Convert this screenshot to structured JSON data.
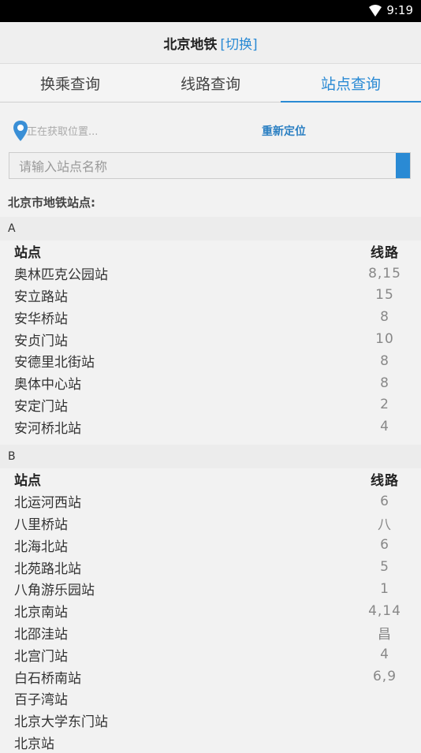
{
  "status": {
    "time": "9:19"
  },
  "header": {
    "title": "北京地铁",
    "switch": "[切换]"
  },
  "tabs": [
    {
      "label": "换乘查询"
    },
    {
      "label": "线路查询"
    },
    {
      "label": "站点查询"
    }
  ],
  "locate": {
    "status": "正在获取位置...",
    "relocate": "重新定位"
  },
  "search": {
    "placeholder": "请输入站点名称"
  },
  "list": {
    "title": "北京市地铁站点:",
    "header": {
      "station": "站点",
      "line": "线路"
    },
    "groups": [
      {
        "letter": "A",
        "rows": [
          {
            "station": "奥林匹克公园站",
            "line": "8,15"
          },
          {
            "station": "安立路站",
            "line": "15"
          },
          {
            "station": "安华桥站",
            "line": "8"
          },
          {
            "station": "安贞门站",
            "line": "10"
          },
          {
            "station": "安德里北街站",
            "line": "8"
          },
          {
            "station": "奥体中心站",
            "line": "8"
          },
          {
            "station": "安定门站",
            "line": "2"
          },
          {
            "station": "安河桥北站",
            "line": "4"
          }
        ]
      },
      {
        "letter": "B",
        "rows": [
          {
            "station": "北运河西站",
            "line": "6"
          },
          {
            "station": "八里桥站",
            "line": "八"
          },
          {
            "station": "北海北站",
            "line": "6"
          },
          {
            "station": "北苑路北站",
            "line": "5"
          },
          {
            "station": "八角游乐园站",
            "line": "1"
          },
          {
            "station": "北京南站",
            "line": "4,14"
          },
          {
            "station": "北邵洼站",
            "line": "昌"
          },
          {
            "station": "北宫门站",
            "line": "4"
          },
          {
            "station": "白石桥南站",
            "line": "6,9"
          },
          {
            "station": "百子湾站",
            "line": ""
          },
          {
            "station": "北京大学东门站",
            "line": ""
          },
          {
            "station": "北京站",
            "line": ""
          }
        ]
      }
    ]
  }
}
